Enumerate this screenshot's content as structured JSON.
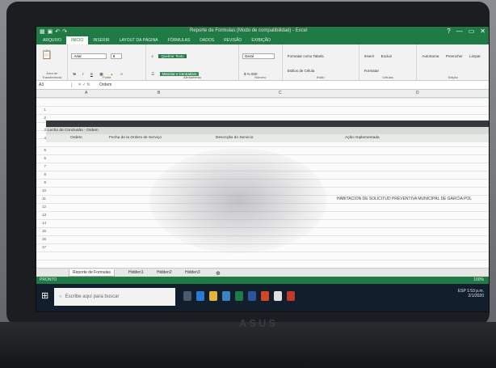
{
  "window": {
    "title": "Reporte de Formulas (Modo de compatibilidad) - Excel",
    "controls": [
      "?",
      "—",
      "▭",
      "✕"
    ]
  },
  "ribbon_tabs": [
    "ARQUIVO",
    "INÍCIO",
    "INSERIR",
    "LAYOUT DA PÁGINA",
    "FÓRMULAS",
    "DADOS",
    "REVISÃO",
    "EXIBIÇÃO"
  ],
  "ribbon": {
    "font_name": "Arial",
    "font_size": "8",
    "wrap_text": "Quebrar Texto",
    "merge": "Mesclar e Centralizar",
    "number_format": "Geral",
    "format_table": "Formatar como Tabela",
    "cell_styles": "Estilos de Célula",
    "insert": "Inserir",
    "delete": "Excluir",
    "format": "Formatar",
    "autosum": "AutoSoma",
    "fill": "Preencher",
    "clear": "Limpar",
    "sort_filter": "Classificar e Filtrar",
    "find_select": "Localizar e Selecionar",
    "groups": [
      "Área de Transferência",
      "Fonte",
      "Alinhamento",
      "Número",
      "Estilo",
      "Células",
      "Edição"
    ]
  },
  "formula_bar": {
    "name_box": "A3",
    "formula": "Ordem"
  },
  "columns": [
    "A",
    "B",
    "C",
    "D"
  ],
  "rows": [
    "1",
    "2",
    "3",
    "4",
    "5",
    "6",
    "7",
    "8",
    "9",
    "10",
    "11",
    "12",
    "13",
    "14",
    "15",
    "16",
    "17"
  ],
  "grid": {
    "row3": [
      "Lecho de Conclusão - Ordem",
      "",
      "",
      ""
    ],
    "row4": [
      "Ordem",
      "Fecha de la Ordem de Serviço",
      "Descrição do Servicio",
      "Ação Implementada"
    ],
    "note": "HABITACION DE SOLICITUD PREVENTIVA MUNICIPAL DE GARCIA POL"
  },
  "sheet_tabs": [
    "Reporte de Formulas",
    "Hidden1",
    "Hidden2",
    "Hidden3"
  ],
  "status": {
    "left": "PRONTO",
    "zoom": "100%"
  },
  "taskbar": {
    "search_placeholder": "Escribe aquí para buscar",
    "time": "1:53 p.m.",
    "date": "2/1/2020",
    "lang": "ESP"
  },
  "laptop_brand": "ASUS"
}
